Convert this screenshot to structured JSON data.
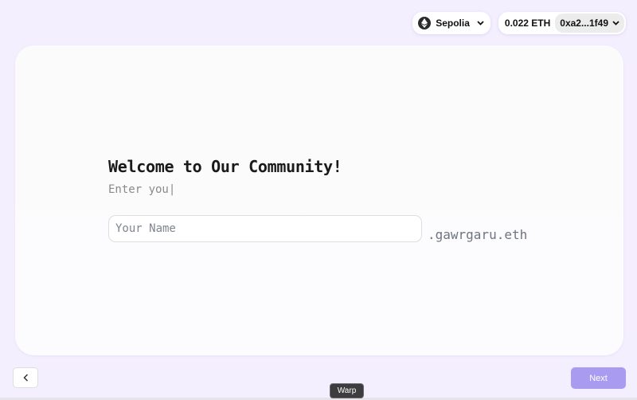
{
  "header": {
    "network": {
      "icon": "ethereum-icon",
      "label": "Sepolia",
      "chevron": "❯"
    },
    "account": {
      "balance": "0.022 ETH",
      "address": "0xa2...1f49",
      "chevron": "❯"
    }
  },
  "form": {
    "title": "Welcome to Our Community!",
    "subtitle": "Enter you|",
    "name_placeholder": "Your Name",
    "name_value": "",
    "domain_suffix": ".gawrgaru.eth"
  },
  "nav": {
    "back_icon": "chevron-left-icon",
    "next_label": "Next"
  },
  "tooltip": {
    "label": "Warp"
  },
  "colors": {
    "background": "#f4efff",
    "card": "#fbfbfb",
    "next_button": "#a99bef",
    "tooltip": "#3d3d40"
  }
}
